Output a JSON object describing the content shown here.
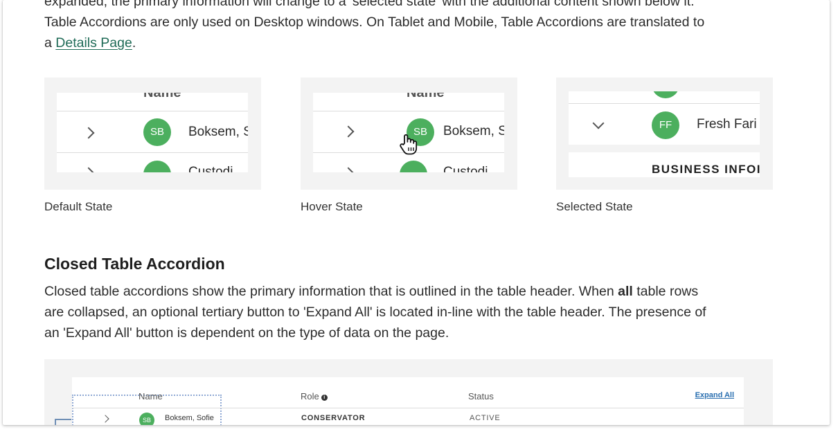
{
  "intro": {
    "line1": "expanded, the primary information will change to a 'selected state' with the additional content shown below it.",
    "line2": "Table Accordions are only used on Desktop windows. On Tablet and Mobile, Table Accordions are translated to",
    "line3_prefix": "a",
    "details_link": "Details Page",
    "line3_suffix": "."
  },
  "states": [
    {
      "caption": "Default State",
      "header_name": "Name",
      "row1_avatar": "SB",
      "row1_text": "Boksem, S",
      "row2_text": "Custodi"
    },
    {
      "caption": "Hover State",
      "header_name": "Name",
      "row1_avatar": "SB",
      "row1_text": "Boksem, S",
      "row2_text": "Custodi"
    },
    {
      "caption": "Selected State",
      "row1_avatar": "FF",
      "row1_text": "Fresh Fari",
      "section_label": "BUSINESS INFOI"
    }
  ],
  "closed_section": {
    "heading": "Closed Table Accordion",
    "text_line1_a": "Closed table accordions show the primary information that is outlined in the table header. When ",
    "text_line1_bold": "all",
    "text_line1_b": " table rows",
    "text_line2": "are collapsed, an optional tertiary button to 'Expand All' is located in-line with the table header. The presence of",
    "text_line3": "an 'Expand All' button is dependent on the type of data on the page."
  },
  "example_table": {
    "headers": {
      "name": "Name",
      "role": "Role",
      "status": "Status"
    },
    "info_glyph": "i",
    "expand_all": "Expand All",
    "row": {
      "avatar": "SB",
      "name": "Boksem, Sofie",
      "role": "CONSERVATOR",
      "status": "ACTIVE"
    }
  },
  "colors": {
    "avatar_green": "#4caf5e",
    "link_green": "#1f6b57",
    "link_blue": "#2a6fb0",
    "panel_gray": "#f3f3f3"
  }
}
